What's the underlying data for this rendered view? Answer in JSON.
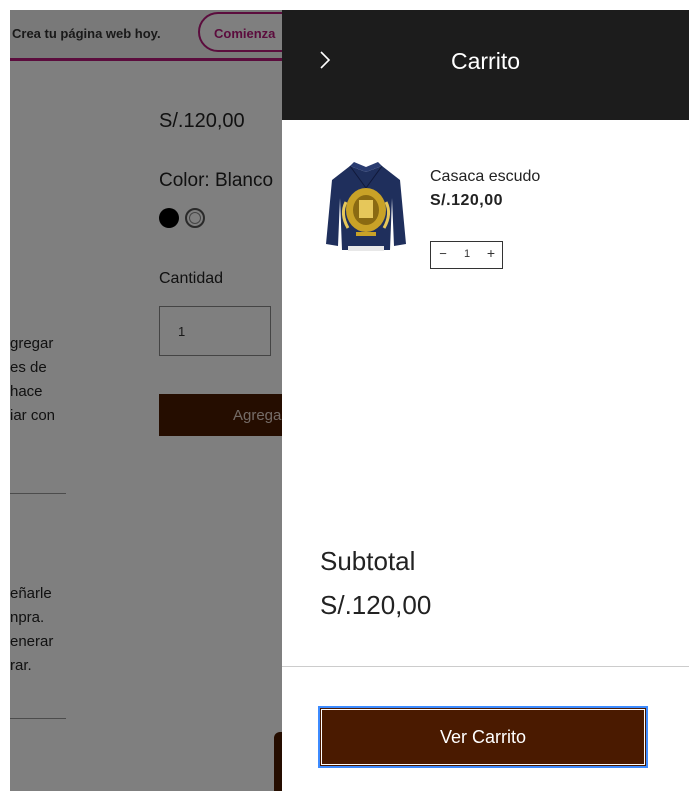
{
  "background_page": {
    "promo": {
      "text": "Crea tu página web hoy.",
      "button_label": "Comienza"
    },
    "description_lines": [
      "gregar",
      "es de",
      "hace",
      "iar con"
    ],
    "shipping_lines": [
      "eñarle",
      "npra.",
      "enerar",
      "rar."
    ],
    "price": "S/.120,00",
    "color_label": "Color: Blanco",
    "swatches": [
      "black",
      "white"
    ],
    "quantity_label": "Cantidad",
    "quantity_value": "1",
    "add_button_label": "Agregar al carrito"
  },
  "cart": {
    "title": "Carrito",
    "items": [
      {
        "name": "Casaca escudo",
        "price": "S/.120,00",
        "quantity": "1"
      }
    ],
    "subtotal_label": "Subtotal",
    "subtotal_value": "S/.120,00",
    "view_cart_label": "Ver Carrito"
  },
  "colors": {
    "header_bg": "#1c1c1c",
    "button_brown": "#4a1a00",
    "promo_accent": "#b6197a",
    "focus_ring": "#3d8bff",
    "jacket_blue": "#1f2f5c",
    "emblem_gold": "#c9a227"
  },
  "icons": {
    "close": "chevron-right-icon",
    "minus": "minus-icon",
    "plus": "plus-icon"
  }
}
